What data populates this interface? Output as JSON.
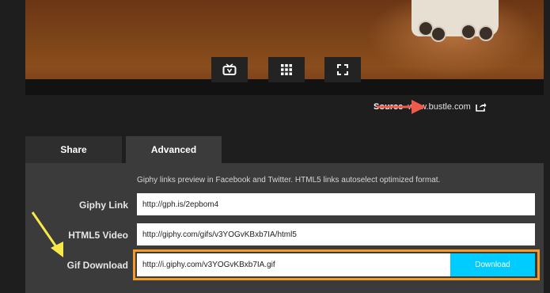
{
  "player": {
    "controls": [
      {
        "name": "tv-icon"
      },
      {
        "name": "grid-icon"
      },
      {
        "name": "fullscreen-icon"
      }
    ]
  },
  "source": {
    "label": "Source",
    "url": "www.bustle.com"
  },
  "tabs": {
    "share": "Share",
    "advanced": "Advanced"
  },
  "advanced": {
    "info": "Giphy links preview in Facebook and Twitter. HTML5 links autoselect optimized format.",
    "giphy_link": {
      "label": "Giphy Link",
      "value": "http://gph.is/2epbom4"
    },
    "html5_video": {
      "label": "HTML5 Video",
      "value": "http://giphy.com/gifs/v3YOGvKBxb7IA/html5"
    },
    "gif_download": {
      "label": "Gif Download",
      "value": "http://i.giphy.com/v3YOGvKBxb7IA.gif",
      "button": "Download"
    }
  },
  "colors": {
    "accent": "#00ccff",
    "highlight": "#f39a27",
    "arrow_red": "#f05a4a",
    "arrow_yellow": "#f5ea4a"
  }
}
